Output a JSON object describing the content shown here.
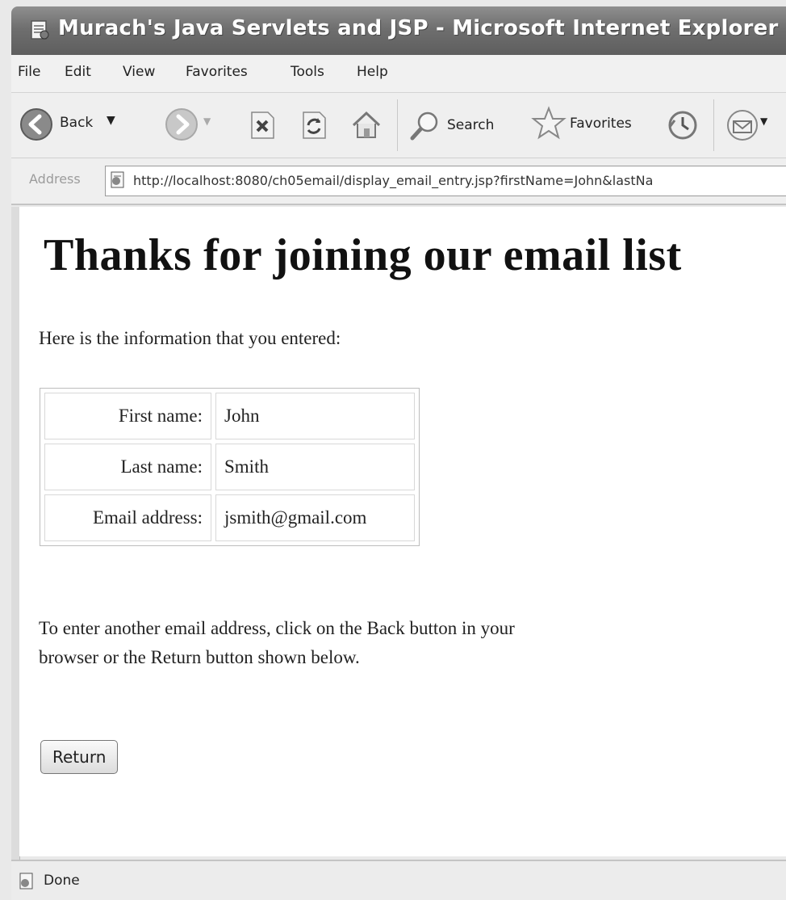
{
  "window": {
    "title": "Murach's Java Servlets and JSP - Microsoft Internet Explorer"
  },
  "menu": {
    "items": [
      "File",
      "Edit",
      "View",
      "Favorites",
      "Tools",
      "Help"
    ]
  },
  "toolbar": {
    "back_label": "Back",
    "search_label": "Search",
    "favorites_label": "Favorites",
    "icons": [
      "back-icon",
      "forward-icon",
      "stop-icon",
      "refresh-icon",
      "home-icon",
      "search-icon",
      "favorites-star-icon",
      "history-icon",
      "mail-icon"
    ]
  },
  "address": {
    "label": "Address",
    "url": "http://localhost:8080/ch05email/display_email_entry.jsp?firstName=John&lastNa"
  },
  "page": {
    "heading": "Thanks for joining our email list",
    "intro": "Here is the information that you entered:",
    "rows": [
      {
        "label": "First name:",
        "value": "John"
      },
      {
        "label": "Last name:",
        "value": "Smith"
      },
      {
        "label": "Email address:",
        "value": "jsmith@gmail.com"
      }
    ],
    "instructions": "To enter another email address, click on the Back button in your browser or the Return button shown below.",
    "return_button": "Return"
  },
  "status": {
    "text": "Done"
  }
}
